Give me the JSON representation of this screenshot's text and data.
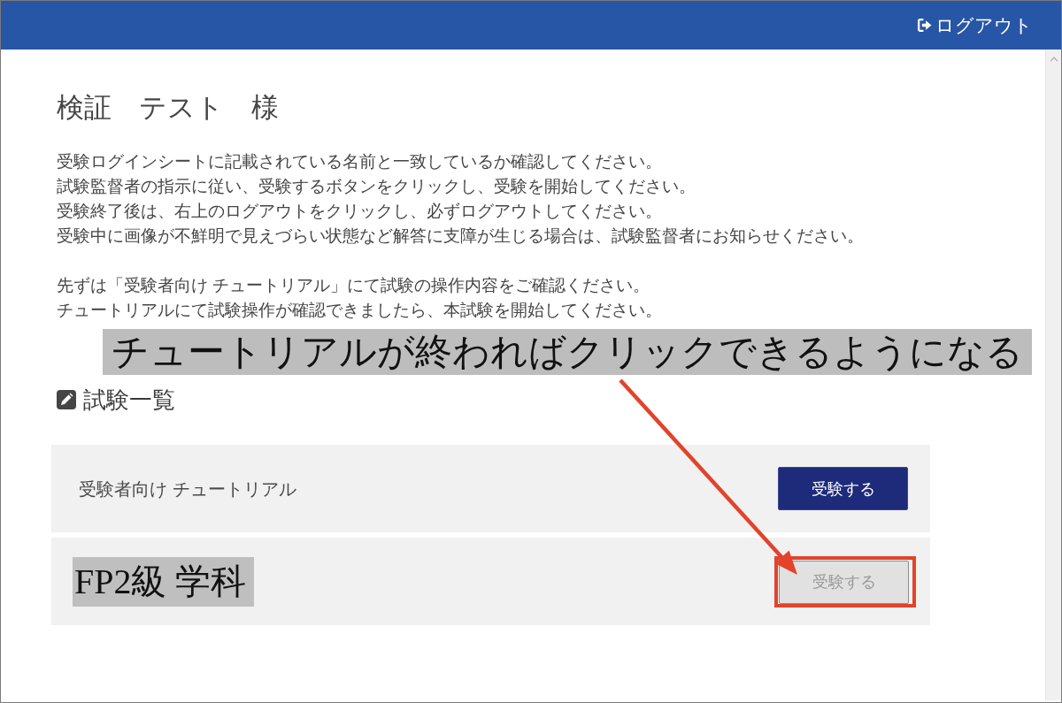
{
  "header": {
    "logout": "ログアウト"
  },
  "user_name": "検証　テスト　様",
  "instructions": [
    [
      "受験ログインシートに記載されている名前と一致しているか確認してください。",
      "試験監督者の指示に従い、受験するボタンをクリックし、受験を開始してください。",
      "受験終了後は、右上のログアウトをクリックし、必ずログアウトしてください。",
      "受験中に画像が不鮮明で見えづらい状態など解答に支障が生じる場合は、試験監督者にお知らせください。"
    ],
    [
      "先ずは「受験者向け チュートリアル」にて試験の操作内容をご確認ください。",
      "チュートリアルにて試験操作が確認できましたら、本試験を開始してください。"
    ]
  ],
  "annotation": {
    "text": "チュートリアルが終わればクリックできるようになる"
  },
  "section_title": "試験一覧",
  "exams": [
    {
      "name": "受験者向け チュートリアル",
      "name_highlighted": false,
      "button": "受験する",
      "disabled": false,
      "button_outlined": false
    },
    {
      "name": "FP2級 学科",
      "name_highlighted": true,
      "button": "受験する",
      "disabled": true,
      "button_outlined": true
    }
  ]
}
